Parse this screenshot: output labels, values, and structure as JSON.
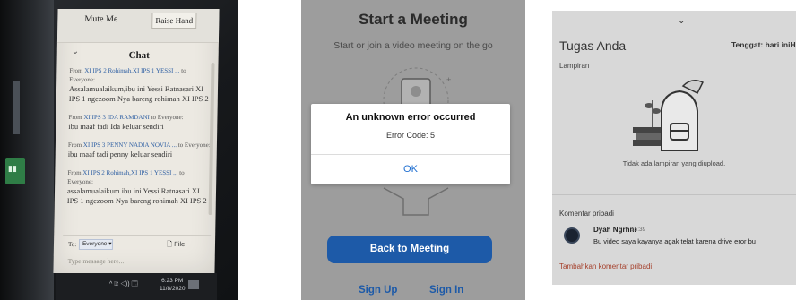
{
  "zoom_chat": {
    "mute_label": "Mute Me",
    "raise_hand_label": "Raise Hand",
    "chat_title": "Chat",
    "messages": [
      {
        "from_prefix": "From",
        "sender": "XI IPS 2 Rohimah,XI IPS 1 YESSI ...",
        "to_text": "to Everyone:",
        "text": "Assalamualaikum,ibu ini Yessi Ratnasari XI IPS 1 ngezoom Nya bareng rohimah XI IPS 2"
      },
      {
        "from_prefix": "From",
        "sender": "XI IPS 3 IDA RAMDANI",
        "to_text": "to Everyone:",
        "text": "ibu maaf tadi Ida keluar sendiri"
      },
      {
        "from_prefix": "From",
        "sender": "XI IPS 3 PENNY NADIA NOVIA ...",
        "to_text": "to Everyone:",
        "text": "ibu maaf tadi penny keluar sendiri"
      },
      {
        "from_prefix": "From",
        "sender": "XI IPS 2 Rohimah,XI IPS 1 YESSI ...",
        "to_text": "to Everyone:",
        "text": "assalamualaikum ibu ini Yessi Ratnasari XI IPS 1 ngezoom Nya bareng rohimah XI IPS 2"
      }
    ],
    "to_label": "To:",
    "recipient": "Everyone ▾",
    "file_label": "File",
    "more_label": "...",
    "placeholder": "Type message here...",
    "clock_time": "6:23 PM",
    "clock_date": "11/8/2020",
    "tray_icons": "^ 🗈 ◁)) 🗔"
  },
  "zoom_start": {
    "title": "Start a Meeting",
    "subtitle": "Start or join a video meeting on the go",
    "dialog": {
      "title": "An unknown error occurred",
      "message": "Error Code: 5",
      "ok": "OK"
    },
    "back_button": "Back to Meeting",
    "sign_up": "Sign Up",
    "sign_in": "Sign In"
  },
  "classroom": {
    "handle": "⌄",
    "title": "Tugas Anda",
    "due": "Tenggat: hari iniHA",
    "attachments_label": "Lampiran",
    "no_attachments": "Tidak ada lampiran yang diupload.",
    "private_comments_label": "Komentar pribadi",
    "comment": {
      "author": "Dyah Ngrhni",
      "time": "15:39",
      "text": "Bu video saya kayanya agak telat karena drive eror bu"
    },
    "add_comment": "Tambahkan komentar pribadi"
  }
}
